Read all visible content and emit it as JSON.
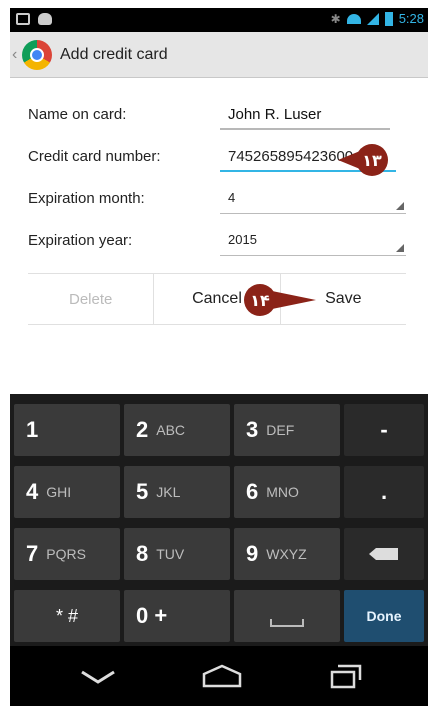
{
  "status_bar": {
    "time": "5:28"
  },
  "action_bar": {
    "title": "Add credit card"
  },
  "form": {
    "name_label": "Name on card:",
    "name_value": "John R. Luser",
    "card_label": "Credit card number:",
    "card_value": "745265895423600",
    "month_label": "Expiration month:",
    "month_value": "4",
    "year_label": "Expiration year:",
    "year_value": "2015"
  },
  "buttons": {
    "delete": "Delete",
    "cancel": "Cancel",
    "save": "Save"
  },
  "callouts": {
    "card": "۱۳",
    "save": "۱۴",
    "color": "#8b2318"
  },
  "keyboard": {
    "rows": [
      [
        {
          "main": "1",
          "sub": ""
        },
        {
          "main": "2",
          "sub": "ABC"
        },
        {
          "main": "3",
          "sub": "DEF"
        },
        {
          "main": "-",
          "sub": ""
        }
      ],
      [
        {
          "main": "4",
          "sub": "GHI"
        },
        {
          "main": "5",
          "sub": "JKL"
        },
        {
          "main": "6",
          "sub": "MNO"
        },
        {
          "main": ".",
          "sub": ""
        }
      ],
      [
        {
          "main": "7",
          "sub": "PQRS"
        },
        {
          "main": "8",
          "sub": "TUV"
        },
        {
          "main": "9",
          "sub": "WXYZ"
        },
        {
          "main": "",
          "sub": ""
        }
      ],
      [
        {
          "main": "* #",
          "sub": ""
        },
        {
          "main": "0 +",
          "sub": ""
        },
        {
          "main": "",
          "sub": ""
        },
        {
          "main": "Done",
          "sub": ""
        }
      ]
    ]
  },
  "icons": {
    "backspace": "backspace-icon",
    "space": "space-bar-icon",
    "nav_back": "back-icon",
    "nav_home": "home-icon",
    "nav_recent": "recent-apps-icon"
  }
}
